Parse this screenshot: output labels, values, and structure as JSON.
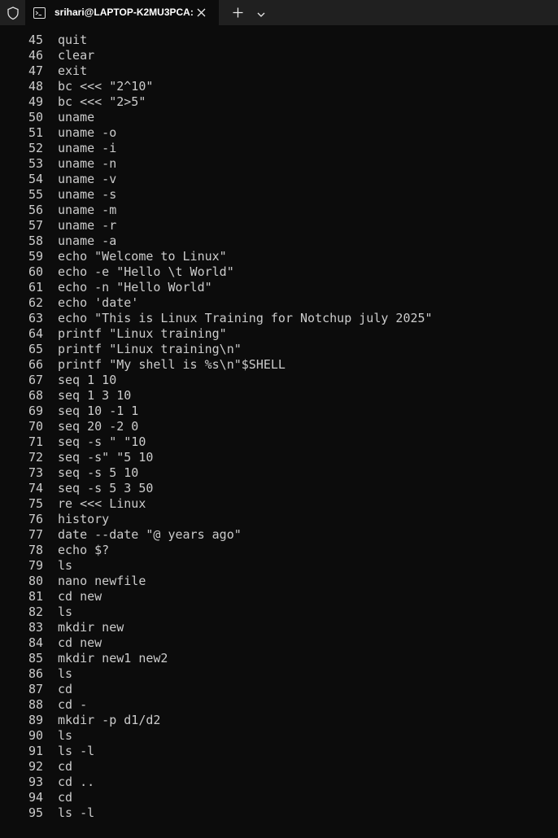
{
  "tab": {
    "title": "srihari@LAPTOP-K2MU3PCA:",
    "icon": "terminal-icon"
  },
  "icons": {
    "shield": "shield-icon",
    "close": "close-icon",
    "new_tab": "plus-icon",
    "dropdown": "chevron-down-icon"
  },
  "colors": {
    "background": "#0c0c0c",
    "titlebar": "#202020",
    "text": "#cccccc"
  },
  "history": [
    {
      "n": "45",
      "cmd": "quit"
    },
    {
      "n": "46",
      "cmd": "clear"
    },
    {
      "n": "47",
      "cmd": "exit"
    },
    {
      "n": "48",
      "cmd": "bc <<< \"2^10\""
    },
    {
      "n": "49",
      "cmd": "bc <<< \"2>5\""
    },
    {
      "n": "50",
      "cmd": "uname"
    },
    {
      "n": "51",
      "cmd": "uname -o"
    },
    {
      "n": "52",
      "cmd": "uname -i"
    },
    {
      "n": "53",
      "cmd": "uname -n"
    },
    {
      "n": "54",
      "cmd": "uname -v"
    },
    {
      "n": "55",
      "cmd": "uname -s"
    },
    {
      "n": "56",
      "cmd": "uname -m"
    },
    {
      "n": "57",
      "cmd": "uname -r"
    },
    {
      "n": "58",
      "cmd": "uname -a"
    },
    {
      "n": "59",
      "cmd": "echo \"Welcome to Linux\""
    },
    {
      "n": "60",
      "cmd": "echo -e \"Hello \\t World\""
    },
    {
      "n": "61",
      "cmd": "echo -n \"Hello World\""
    },
    {
      "n": "62",
      "cmd": "echo 'date'"
    },
    {
      "n": "63",
      "cmd": "echo \"This is Linux Training for Notchup july 2025\""
    },
    {
      "n": "64",
      "cmd": "printf \"Linux training\""
    },
    {
      "n": "65",
      "cmd": "printf \"Linux training\\n\""
    },
    {
      "n": "66",
      "cmd": "printf \"My shell is %s\\n\"$SHELL"
    },
    {
      "n": "67",
      "cmd": "seq 1 10"
    },
    {
      "n": "68",
      "cmd": "seq 1 3 10"
    },
    {
      "n": "69",
      "cmd": "seq 10 -1 1"
    },
    {
      "n": "70",
      "cmd": "seq 20 -2 0"
    },
    {
      "n": "71",
      "cmd": "seq -s \" \"10"
    },
    {
      "n": "72",
      "cmd": "seq -s\" \"5 10"
    },
    {
      "n": "73",
      "cmd": "seq -s 5 10"
    },
    {
      "n": "74",
      "cmd": "seq -s 5 3 50"
    },
    {
      "n": "75",
      "cmd": "re <<< Linux"
    },
    {
      "n": "76",
      "cmd": "history"
    },
    {
      "n": "77",
      "cmd": "date --date \"@ years ago\""
    },
    {
      "n": "78",
      "cmd": "echo $?"
    },
    {
      "n": "79",
      "cmd": "ls"
    },
    {
      "n": "80",
      "cmd": "nano newfile"
    },
    {
      "n": "81",
      "cmd": "cd new"
    },
    {
      "n": "82",
      "cmd": "ls"
    },
    {
      "n": "83",
      "cmd": "mkdir new"
    },
    {
      "n": "84",
      "cmd": "cd new"
    },
    {
      "n": "85",
      "cmd": "mkdir new1 new2"
    },
    {
      "n": "86",
      "cmd": "ls"
    },
    {
      "n": "87",
      "cmd": "cd"
    },
    {
      "n": "88",
      "cmd": "cd -"
    },
    {
      "n": "89",
      "cmd": "mkdir -p d1/d2"
    },
    {
      "n": "90",
      "cmd": "ls"
    },
    {
      "n": "91",
      "cmd": "ls -l"
    },
    {
      "n": "92",
      "cmd": "cd"
    },
    {
      "n": "93",
      "cmd": "cd .."
    },
    {
      "n": "94",
      "cmd": "cd"
    },
    {
      "n": "95",
      "cmd": "ls -l"
    }
  ]
}
